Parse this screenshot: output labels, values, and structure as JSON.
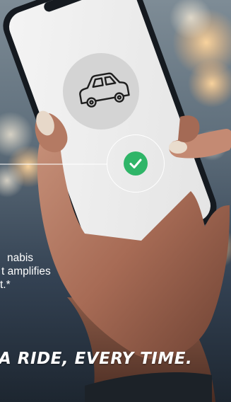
{
  "overlay_text": {
    "line1": "nabis",
    "line2": "t amplifies",
    "line3": "t.*"
  },
  "headline": "A RIDE, EVERY TIME.",
  "icons": {
    "phone_image": "car-icon",
    "confirm": "check-icon"
  },
  "colors": {
    "check_green": "#2fb568",
    "phone_screen": "#ededed",
    "background_dark": "#3a4655"
  }
}
